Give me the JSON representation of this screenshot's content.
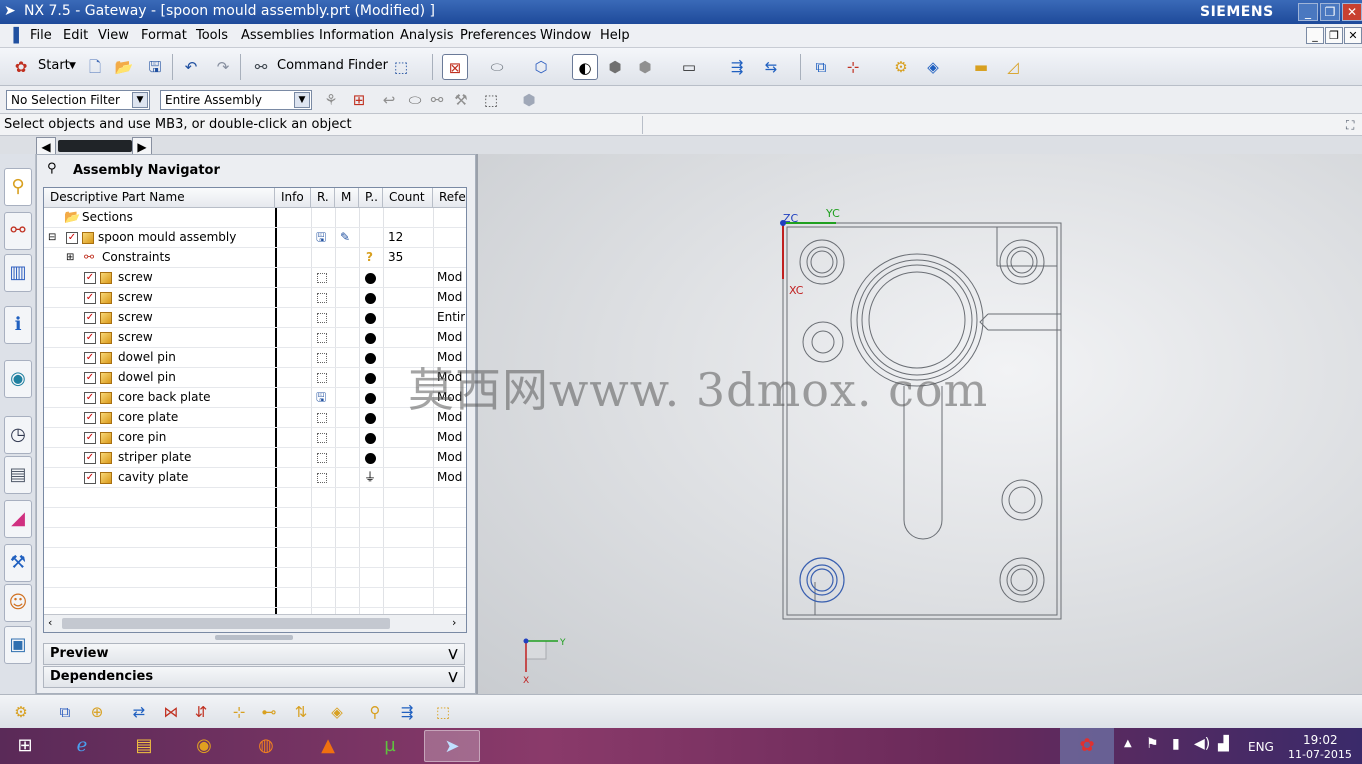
{
  "window": {
    "title": "NX 7.5 - Gateway - [spoon mould assembly.prt (Modified) ]",
    "brand": "SIEMENS"
  },
  "menu": [
    "File",
    "Edit",
    "View",
    "Format",
    "Tools",
    "Assemblies",
    "Information",
    "Analysis",
    "Preferences",
    "Window",
    "Help"
  ],
  "toolbar": {
    "start_label": "Start",
    "command_finder_label": "Command Finder"
  },
  "selection": {
    "filter": "No Selection Filter",
    "scope": "Entire Assembly"
  },
  "cue_line": "Select objects and use MB3, or double-click an object",
  "navigator": {
    "title": "Assembly Navigator",
    "columns": [
      "Descriptive Part Name",
      "Info",
      "R.",
      "M",
      "P..",
      "Count",
      "Refe"
    ],
    "sections_label": "Sections",
    "root": {
      "name": "spoon mould assembly",
      "count": "12"
    },
    "constraints": {
      "name": "Constraints",
      "count": "35"
    },
    "parts": [
      {
        "name": "screw",
        "ref": "Mod"
      },
      {
        "name": "screw",
        "ref": "Mod"
      },
      {
        "name": "screw",
        "ref": "Entir"
      },
      {
        "name": "screw",
        "ref": "Mod"
      },
      {
        "name": "dowel pin",
        "ref": "Mod"
      },
      {
        "name": "dowel pin",
        "ref": "Mod"
      },
      {
        "name": "core  back plate",
        "ref": "Mod"
      },
      {
        "name": "core plate",
        "ref": "Mod"
      },
      {
        "name": "core pin",
        "ref": "Mod"
      },
      {
        "name": "striper plate",
        "ref": "Mod"
      },
      {
        "name": "cavity plate",
        "ref": "Mod"
      }
    ]
  },
  "panels": {
    "preview": "Preview",
    "dependencies": "Dependencies"
  },
  "viewport": {
    "axis_zc": "ZC",
    "axis_yc": "YC",
    "axis_xc": "XC",
    "triad_y": "Y",
    "triad_x": "X",
    "watermark": "莫西网www. 3dmox. com"
  },
  "taskbar": {
    "lang": "ENG",
    "time": "19:02",
    "date": "11-07-2015"
  }
}
